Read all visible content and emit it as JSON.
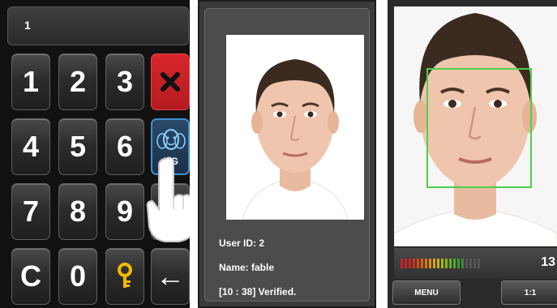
{
  "keypad": {
    "display_value": "1",
    "keys": [
      "1",
      "2",
      "3",
      "4",
      "5",
      "6",
      "7",
      "8",
      "9",
      "C",
      "0",
      "←"
    ],
    "delete_key_color": "#c8202a",
    "face_key_label": "1:G"
  },
  "verification": {
    "user_id": "User ID: 2",
    "name": "Name: fable",
    "status": "[10 : 38] Verified."
  },
  "capture": {
    "count": "13",
    "menu_label": "MENU",
    "mode_label": "1:1",
    "detect_box_color": "#4ccf4c"
  }
}
